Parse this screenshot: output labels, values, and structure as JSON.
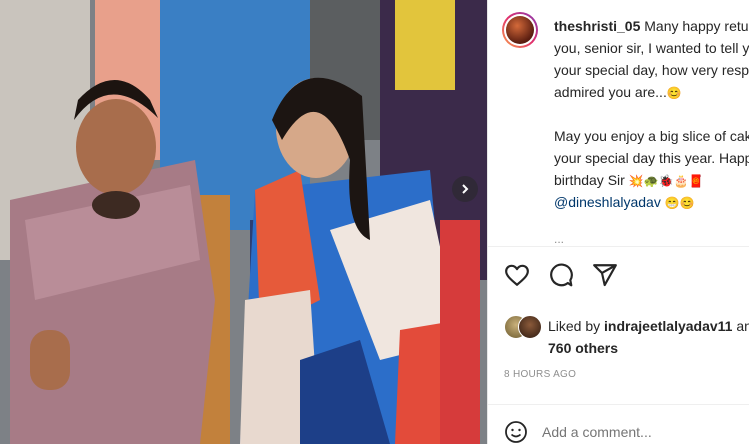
{
  "post": {
    "username": "theshristi_05",
    "caption_lines": [
      " Many happy retur",
      "you, senior sir, I wanted to tell y",
      "your special day, how very respo",
      "admired you are...",
      "May you enjoy a big slice of cak",
      "your special day this year. Happ",
      "birthday Sir",
      "@dineshlalyadav"
    ],
    "emoji_1": "😊",
    "emoji_2": "💥🐢🐞🎂🧧",
    "emoji_3": "😁😊",
    "more": "..."
  },
  "actions": {
    "like_icon": "heart-icon",
    "comment_icon": "comment-icon",
    "share_icon": "send-icon"
  },
  "likes": {
    "prefix": "Liked by ",
    "user": "indrajeetlalyadav11",
    "suffix": " and",
    "others": "760 others"
  },
  "time_ago": "8 HOURS AGO",
  "comment": {
    "placeholder": "Add a comment..."
  },
  "colors": {
    "text": "#262626",
    "muted": "#8e8e8e",
    "link": "#00376b"
  }
}
